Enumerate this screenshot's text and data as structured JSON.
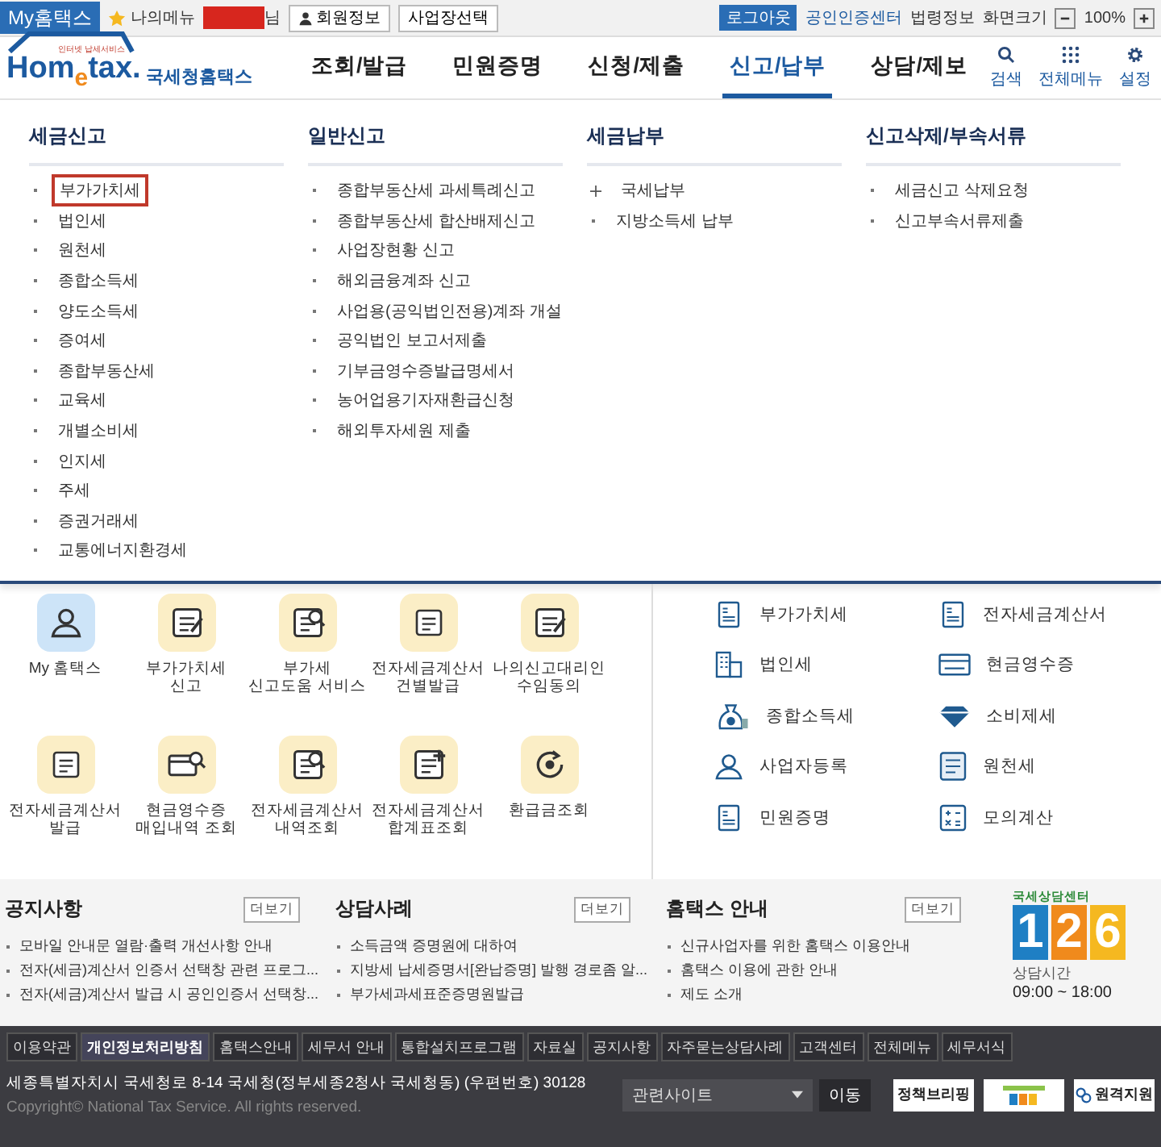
{
  "top_bar": {
    "my_hometax": "My홈택스",
    "my_menu": "나의메뉴",
    "user_suffix": "님",
    "member_info": "회원정보",
    "workplace_select": "사업장선택",
    "logout": "로그아웃",
    "cert_center": "공인인증센터",
    "law_info": "법령정보",
    "screen_size": "화면크기",
    "zoom_level": "100%"
  },
  "header": {
    "logo_tagline": "인터넷 납세서비스",
    "logo_text": "Hom$_{e}$tax.",
    "logo_name": "국세청홈택스",
    "nav": [
      {
        "label": "조회/발급",
        "selected": false
      },
      {
        "label": "민원증명",
        "selected": false
      },
      {
        "label": "신청/제출",
        "selected": false
      },
      {
        "label": "신고/납부",
        "selected": true
      },
      {
        "label": "상담/제보",
        "selected": false
      }
    ],
    "tools": [
      {
        "label": "검색"
      },
      {
        "label": "전체메뉴"
      },
      {
        "label": "설정"
      }
    ]
  },
  "mega_menu": [
    {
      "title": "세금신고",
      "items": [
        {
          "label": "부가가치세",
          "highlighted": true
        },
        {
          "label": "법인세",
          "highlighted": false
        },
        {
          "label": "원천세",
          "highlighted": false
        },
        {
          "label": "종합소득세",
          "highlighted": false
        },
        {
          "label": "양도소득세",
          "highlighted": false
        },
        {
          "label": "증여세",
          "highlighted": false
        },
        {
          "label": "종합부동산세",
          "highlighted": false
        },
        {
          "label": "교육세",
          "highlighted": false
        },
        {
          "label": "개별소비세",
          "highlighted": false
        },
        {
          "label": "인지세",
          "highlighted": false
        },
        {
          "label": "주세",
          "highlighted": false
        },
        {
          "label": "증권거래세",
          "highlighted": false
        },
        {
          "label": "교통에너지환경세",
          "highlighted": false
        }
      ]
    },
    {
      "title": "일반신고",
      "items": [
        {
          "label": "종합부동산세 과세특례신고",
          "highlighted": false
        },
        {
          "label": "종합부동산세 합산배제신고",
          "highlighted": false
        },
        {
          "label": "사업장현황 신고",
          "highlighted": false
        },
        {
          "label": "해외금융계좌 신고",
          "highlighted": false
        },
        {
          "label": "사업용(공익법인전용)계좌 개설",
          "highlighted": false
        },
        {
          "label": "공익법인 보고서제출",
          "highlighted": false
        },
        {
          "label": "기부금영수증발급명세서",
          "highlighted": false
        },
        {
          "label": "농어업용기자재환급신청",
          "highlighted": false
        },
        {
          "label": "해외투자세원 제출",
          "highlighted": false
        }
      ]
    },
    {
      "title": "세금납부",
      "items": [
        {
          "label": "국세납부",
          "highlighted": false,
          "kind": "expandable"
        },
        {
          "label": "지방소득세 납부",
          "highlighted": false,
          "kind": "link"
        }
      ]
    },
    {
      "title": "신고삭제/부속서류",
      "items": [
        {
          "label": "세금신고 삭제요청",
          "highlighted": false
        },
        {
          "label": "신고부속서류제출",
          "highlighted": false
        }
      ]
    }
  ],
  "services": [
    {
      "label": "My 홈택스",
      "kind": "personal"
    },
    {
      "label": "부가가치세\n신고",
      "kind": "service"
    },
    {
      "label": "부가세\n신고도움 서비스",
      "kind": "service"
    },
    {
      "label": "전자세금계산서\n건별발급",
      "kind": "service"
    },
    {
      "label": "나의신고대리인\n수임동의",
      "kind": "service"
    },
    {
      "label": "전자세금계산서\n발급",
      "kind": "service"
    },
    {
      "label": "현금영수증\n매입내역 조회",
      "kind": "service"
    },
    {
      "label": "전자세금계산서\n내역조회",
      "kind": "service"
    },
    {
      "label": "전자세금계산서\n합계표조회",
      "kind": "service"
    },
    {
      "label": "환급금조회",
      "kind": "service"
    }
  ],
  "quick_links": [
    "부가가치세",
    "전자세금계산서",
    "법인세",
    "현금영수증",
    "종합소득세",
    "소비제세",
    "사업자등록",
    "원천세",
    "민원증명",
    "모의계산"
  ],
  "boards": [
    {
      "title": "공지사항",
      "more": "더보기",
      "items": [
        "모바일 안내문 열람·출력 개선사항 안내",
        "전자(세금)계산서 인증서 선택창 관련 프로그...",
        "전자(세금)계산서 발급 시 공인인증서 선택창..."
      ]
    },
    {
      "title": "상담사례",
      "more": "더보기",
      "items": [
        "소득금액 증명원에 대하여",
        "지방세 납세증명서[완납증명] 발행 경로좀 알...",
        "부가세과세표준증명원발급"
      ]
    },
    {
      "title": "홈택스 안내",
      "more": "더보기",
      "items": [
        "신규사업자를 위한 홈택스 이용안내",
        "홈택스 이용에 관한 안내",
        "제도 소개"
      ]
    }
  ],
  "call_center": {
    "title": "국세상담센터",
    "digits": [
      {
        "text": "1",
        "color": "#1f7fc4"
      },
      {
        "text": "2",
        "color": "#f08a1c"
      },
      {
        "text": "6",
        "color": "#f5b820"
      }
    ],
    "hours_label": "상담시간",
    "hours": "09:00 ~ 18:00"
  },
  "footer": {
    "links": [
      {
        "label": "이용약관",
        "selected": false
      },
      {
        "label": "개인정보처리방침",
        "selected": true
      },
      {
        "label": "홈택스안내",
        "selected": false
      },
      {
        "label": "세무서 안내",
        "selected": false
      },
      {
        "label": "통합설치프로그램",
        "selected": false
      },
      {
        "label": "자료실",
        "selected": false
      },
      {
        "label": "공지사항",
        "selected": false
      },
      {
        "label": "자주묻는상담사례",
        "selected": false
      },
      {
        "label": "고객센터",
        "selected": false
      },
      {
        "label": "전체메뉴",
        "selected": false
      },
      {
        "label": "세무서식",
        "selected": false
      }
    ],
    "address": "세종특별자치시 국세청로 8-14 국세청(정부세종2청사 국세청동) (우편번호) 30128",
    "copyright": "Copyright© National Tax Service. All rights reserved.",
    "related_select": "관련사이트",
    "go": "이동",
    "banners": [
      {
        "kind": "text",
        "label": "정책브리핑"
      },
      {
        "kind": "logo"
      },
      {
        "kind": "remote",
        "label": "원격지원"
      }
    ]
  }
}
